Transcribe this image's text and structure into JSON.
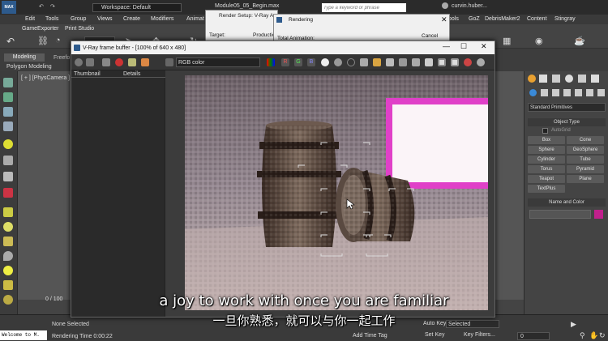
{
  "app": {
    "title": "Module05_05_Begin.max",
    "workspace": "Workspace: Default",
    "search_placeholder": "Type a keyword or phrase",
    "user": "curvin.huber...",
    "logo": "MAX"
  },
  "menu": {
    "items_left": [
      "Edit",
      "Tools",
      "Group",
      "Views",
      "Create",
      "Modifiers",
      "Animat"
    ],
    "items_right": [
      "ools",
      "GoZ",
      "DebrisMaker2",
      "Content",
      "Stingray"
    ],
    "row2": [
      "GameExporter",
      "Print Studio"
    ]
  },
  "ribbon": {
    "tabs": [
      "Modeling",
      "Freefo"
    ],
    "sub": "Polygon Modeling"
  },
  "viewport": {
    "label": "[ + ] [PhysCamera ] [ St"
  },
  "render_setup": {
    "title": "Render Setup: V-Ray A",
    "target_label": "Target:",
    "production": "Productio"
  },
  "rendering_dialog": {
    "title": "Rendering",
    "total_animation": "Total Animation:",
    "cancel": "Cancel"
  },
  "vfb": {
    "title": "V-Ray frame buffer - [100% of 640 x 480]",
    "channel": "RGB color",
    "history_cols": [
      "Thumbnail",
      "Details"
    ],
    "channel_buttons": [
      "R",
      "G",
      "B"
    ]
  },
  "command_panel": {
    "dropdown": "Standard Primitives",
    "object_type_header": "Object Type",
    "autogrid": "AutoGrid",
    "buttons": [
      "Box",
      "Cone",
      "Sphere",
      "GeoSphere",
      "Cylinder",
      "Tube",
      "Torus",
      "Pyramid",
      "Teapot",
      "Plane",
      "TextPlus"
    ],
    "name_color_header": "Name and Color"
  },
  "status": {
    "timeline": "0 / 100",
    "maxscript": "Welcome to M.",
    "selection": "None Selected",
    "render_time": "Rendering Time  0:00:22",
    "add_time_tag": "Add Time Tag",
    "auto_key": "Auto Key",
    "set_key": "Set Key",
    "selected_option": "Selected",
    "key_filters": "Key Filters...",
    "frame": "0"
  },
  "subtitles": {
    "english": "a joy to work with once you are familiar",
    "chinese": "一旦你熟悉，就可以与你一起工作"
  },
  "colors": {
    "pink_window": "#e040c8",
    "accent": "#c0208c"
  }
}
